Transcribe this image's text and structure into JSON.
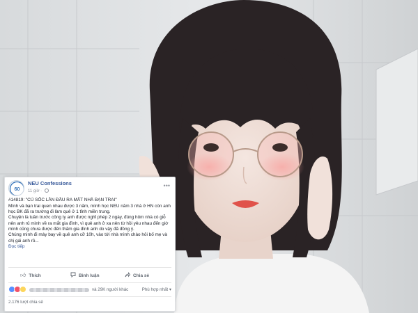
{
  "colors": {
    "facebook_link": "#365899",
    "text": "#1d2129",
    "muted": "#90949c",
    "like_blue": "#5890ff",
    "love_red": "#f25268",
    "haha_yellow": "#fcd65c"
  },
  "post": {
    "page_name": "NEU Confessions",
    "time": "11 giờ",
    "more_icon": "more-dots-icon",
    "title": "#14819: \"CÚ SỐC LẦN ĐẦU RA MẮT NHÀ BẠN TRAI\"",
    "paragraphs": [
      "Mình và bạn trai quen nhau được 3 năm, mình học NEU năm 3 nhà ở HN còn anh học BK đã ra trường đi làm quê ở 1 tỉnh miền trung.",
      "Chuyện là tuần trước công ty anh được nghỉ phép 2 ngày, đúng hôm nhà có giỗ nên anh rủ mình về ra mắt gia đình, vì quê anh ở xa nên từ hồi yêu nhau đến giờ mình cũng chưa được đến thăm gia đình anh do vậy đã đồng ý.",
      "Chúng mình đi máy bay về quê anh cỡ 10h, vào tới nhà mình chào hỏi bố mẹ và chị gái anh rồ..."
    ],
    "see_more": "Đọc tiếp"
  },
  "actions": {
    "like": "Thích",
    "comment": "Bình luận",
    "share": "Chia sẻ"
  },
  "reactions": {
    "count_text": "và 29K người khác",
    "sort_label": "Phù hợp nhất",
    "shares_text": "2.176 lượt chia sẻ"
  }
}
